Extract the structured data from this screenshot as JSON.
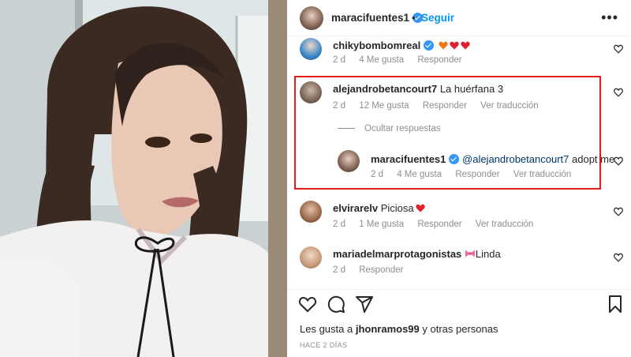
{
  "colors": {
    "accent": "#0095f6",
    "highlight": "#e21b1b",
    "verified": "#3897f0",
    "heart_red": "#e0202c",
    "heart_orange": "#f07a1a"
  },
  "header": {
    "username": "maracifuentes1",
    "separator": "•",
    "follow_label": "Seguir",
    "more_label": "•••"
  },
  "comments": [
    {
      "username": "chikybombomreal",
      "text": "",
      "emojis": [
        "orange-heart",
        "red-heart",
        "red-heart"
      ],
      "time": "2 d",
      "likes": "4 Me gusta",
      "reply_label": "Responder",
      "translate_label": ""
    },
    {
      "username": "alejandrobetancourt7",
      "text": "La huérfana 3",
      "time": "2 d",
      "likes": "12 Me gusta",
      "reply_label": "Responder",
      "translate_label": "Ver traducción"
    },
    {
      "username": "elvirarelv",
      "text": "Piciosa",
      "emojis": [
        "red-heart"
      ],
      "time": "2 d",
      "likes": "1 Me gusta",
      "reply_label": "Responder",
      "translate_label": "Ver traducción"
    },
    {
      "username": "mariadelmarprotagonistas",
      "text": "Linda",
      "emojis": [
        "pink-bow"
      ],
      "time": "2 d",
      "likes": "",
      "reply_label": "Responder",
      "translate_label": ""
    }
  ],
  "replies_toggle": "Ocultar respuestas",
  "reply": {
    "username": "maracifuentes1",
    "mention": "@alejandrobetancourt7",
    "text": "adopt me",
    "time": "2 d",
    "likes": "4 Me gusta",
    "reply_label": "Responder",
    "translate_label": "Ver traducción"
  },
  "footer": {
    "likes_prefix": "Les gusta a",
    "likes_user": "jhonramos99",
    "likes_suffix": "y otras personas",
    "time_ago": "HACE 2 DÍAS"
  },
  "icons": [
    "heart-icon",
    "comment-icon",
    "share-icon",
    "bookmark-icon",
    "verified-icon",
    "more-icon"
  ]
}
